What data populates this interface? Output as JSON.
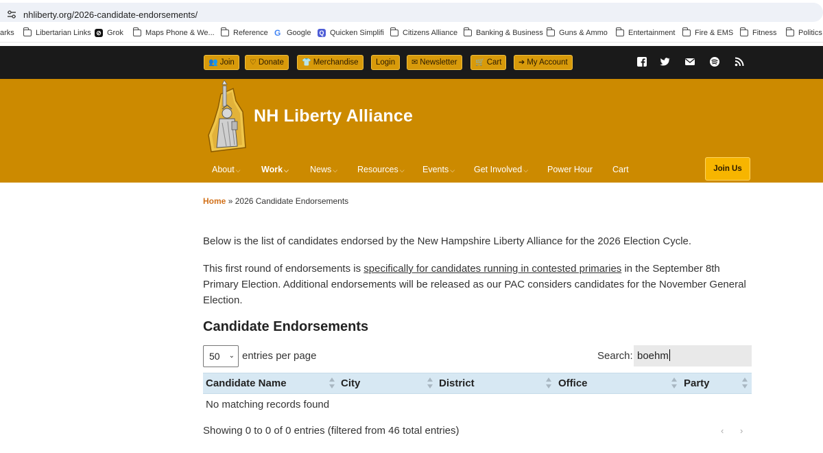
{
  "browser": {
    "url": "nhliberty.org/2026-candidate-endorsements/",
    "bookmarks": [
      {
        "label": "arks",
        "icon": "none"
      },
      {
        "label": "Libertarian Links",
        "icon": "folder-icon"
      },
      {
        "label": "Grok",
        "icon": "grok-icon"
      },
      {
        "label": "Maps Phone & We...",
        "icon": "folder-icon"
      },
      {
        "label": "Reference",
        "icon": "folder-icon"
      },
      {
        "label": "Google",
        "icon": "google-icon"
      },
      {
        "label": "Quicken Simplifi",
        "icon": "quicken-icon"
      },
      {
        "label": "Citizens Alliance",
        "icon": "folder-icon"
      },
      {
        "label": "Banking & Business",
        "icon": "folder-icon"
      },
      {
        "label": "Guns & Ammo",
        "icon": "folder-icon"
      },
      {
        "label": "Entertainment",
        "icon": "folder-icon"
      },
      {
        "label": "Fire & EMS",
        "icon": "folder-icon"
      },
      {
        "label": "Fitness",
        "icon": "folder-icon"
      },
      {
        "label": "Politics",
        "icon": "folder-icon"
      }
    ]
  },
  "topbar": {
    "buttons": [
      {
        "label": "Join",
        "icon": "users-icon"
      },
      {
        "label": "Donate",
        "icon": "donate-icon"
      },
      {
        "label": "Merchandise",
        "icon": "tshirt-icon"
      },
      {
        "label": "Login",
        "icon": "none"
      },
      {
        "label": "Newsletter",
        "icon": "envelope-icon"
      },
      {
        "label": "Cart",
        "icon": "cart-icon"
      },
      {
        "label": "My Account",
        "icon": "sign-in-icon"
      }
    ],
    "social": [
      "facebook-icon",
      "twitter-icon",
      "email-icon",
      "spotify-icon",
      "rss-icon"
    ]
  },
  "header": {
    "site_title": "NH Liberty Alliance",
    "nav": [
      {
        "label": "About",
        "dropdown": true
      },
      {
        "label": "Work",
        "dropdown": true,
        "active": true
      },
      {
        "label": "News",
        "dropdown": true
      },
      {
        "label": "Resources",
        "dropdown": true
      },
      {
        "label": "Events",
        "dropdown": true
      },
      {
        "label": "Get Involved",
        "dropdown": true
      },
      {
        "label": "Power Hour",
        "dropdown": false
      },
      {
        "label": "Cart",
        "dropdown": false
      }
    ],
    "join_us": "Join Us"
  },
  "content": {
    "breadcrumb_home": "Home",
    "breadcrumb_sep": "»",
    "breadcrumb_current": "2026 Candidate Endorsements",
    "intro": "Below is the list of candidates endorsed by the New Hampshire Liberty Alliance for the 2026 Election Cycle.",
    "round_pre": "This first round of endorsements is ",
    "round_link": "specifically for candidates running in contested primaries",
    "round_post": " in the September 8th Primary Election.  Additional endorsements will be released as our PAC considers candidates for the November General Election.",
    "section_title": "Candidate Endorsements"
  },
  "table": {
    "page_size": "50",
    "entries_label": "entries per page",
    "search_label": "Search:",
    "search_value": "boehm",
    "columns": [
      "Candidate Name",
      "City",
      "District",
      "Office",
      "Party"
    ],
    "empty_message": "No matching records found",
    "info": "Showing 0 to 0 of 0 entries (filtered from 46 total entries)",
    "prev": "‹",
    "next": "›"
  },
  "colors": {
    "header_gold": "#cc8a00",
    "topbar_black": "#1a1a1a",
    "button_gold": "#d89a0a",
    "table_header": "#d7e8f3",
    "breadcrumb_link": "#d2711a"
  }
}
